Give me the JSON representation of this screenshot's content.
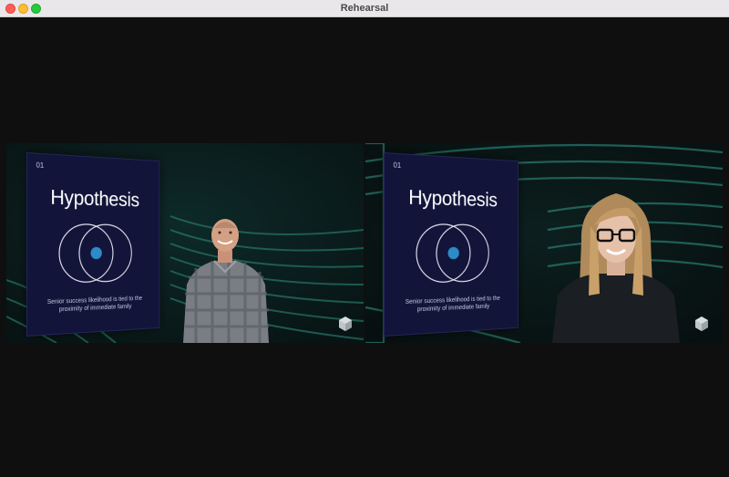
{
  "window": {
    "title": "Rehearsal"
  },
  "tiles": [
    {
      "slide": {
        "number": "01",
        "title": "Hypothesis",
        "caption": "Senior success likelihood is tied to the proximity of immediate family"
      }
    },
    {
      "slide": {
        "number": "01",
        "title": "Hypothesis",
        "caption": "Senior success likelihood is tied to the proximity of immediate family"
      }
    }
  ],
  "colors": {
    "slide_bg": "#12143a",
    "accent_dot": "#2d8bc7",
    "teal_bg": "#1e6f63"
  },
  "icons": {
    "close": "close-icon",
    "minimize": "minimize-icon",
    "maximize": "maximize-icon",
    "logo": "cube-logo-icon"
  }
}
